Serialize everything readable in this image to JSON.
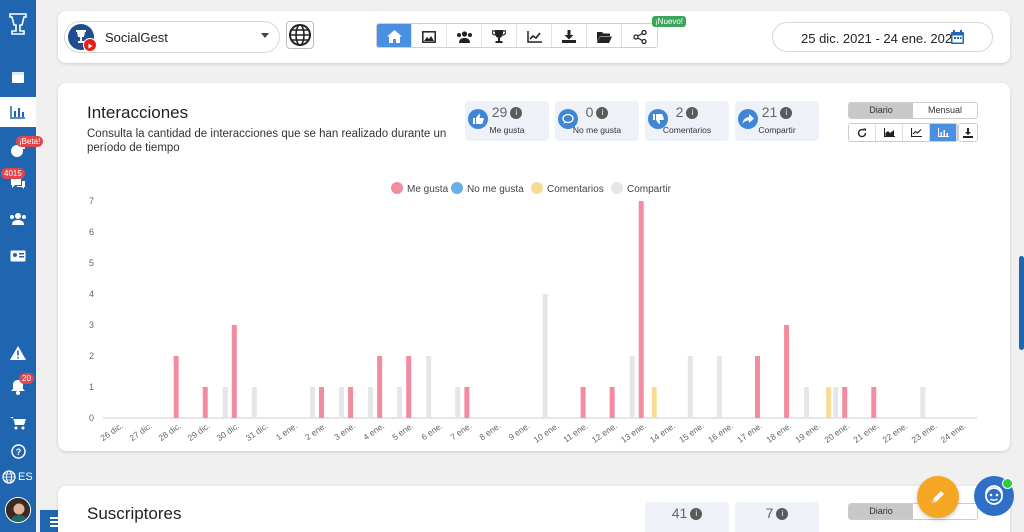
{
  "sidebar": {
    "items": [
      {
        "icon": "cup-logo-icon"
      },
      {
        "icon": "calendar-icon"
      },
      {
        "icon": "bar-chart-icon",
        "active": true
      },
      {
        "icon": "pie-chart-icon",
        "badge": "¡Beta!"
      },
      {
        "icon": "chat-icon",
        "badge": "4015"
      },
      {
        "icon": "users-icon"
      },
      {
        "icon": "id-card-icon"
      },
      {
        "icon": "warning-icon"
      },
      {
        "icon": "bell-icon",
        "badge": "20"
      },
      {
        "icon": "cart-icon"
      },
      {
        "icon": "help-icon"
      }
    ],
    "language": "ES"
  },
  "topbar": {
    "account_name": "SocialGest",
    "nuevo_badge": "¡Nuevo!",
    "date_range": "25 dic. 2021 - 24 ene. 2022",
    "nav_icons": [
      "home-icon",
      "image-icon",
      "users-icon",
      "trophy-icon",
      "line-chart-icon",
      "download-icon",
      "folder-icon",
      "share-nodes-icon"
    ]
  },
  "interactions": {
    "title": "Interacciones",
    "description": "Consulta la cantidad de interacciones que se han realizado durante un período de tiempo",
    "stats": [
      {
        "value": "29",
        "label": "Me gusta",
        "icon": "thumbs-up-icon"
      },
      {
        "value": "0",
        "label": "No me gusta",
        "icon": "speech-bubble-icon"
      },
      {
        "value": "2",
        "label": "Comentarios",
        "icon": "thumbs-down-icon"
      },
      {
        "value": "21",
        "label": "Compartir",
        "icon": "share-arrow-icon"
      }
    ],
    "period": {
      "daily": "Diario",
      "monthly": "Mensual"
    },
    "info_glyph": "i"
  },
  "chart_data": {
    "type": "bar",
    "categories": [
      "26 dic.",
      "27 dic.",
      "28 dic.",
      "29 dic.",
      "30 dic.",
      "31 dic.",
      "1 ene.",
      "2 ene.",
      "3 ene.",
      "4 ene.",
      "5 ene.",
      "6 ene.",
      "7 ene.",
      "8 ene.",
      "9 ene.",
      "10 ene.",
      "11 ene.",
      "12 ene.",
      "13 ene.",
      "14 ene.",
      "15 ene.",
      "16 ene.",
      "17 ene.",
      "18 ene.",
      "19 ene.",
      "20 ene.",
      "21 ene.",
      "22 ene.",
      "23 ene.",
      "24 ene."
    ],
    "series": [
      {
        "name": "Me gusta",
        "color": "#f48ca0",
        "values": [
          0,
          0,
          2,
          1,
          3,
          0,
          0,
          1,
          1,
          2,
          2,
          0,
          1,
          0,
          0,
          0,
          1,
          1,
          7,
          0,
          0,
          0,
          2,
          3,
          0,
          1,
          1,
          0,
          0,
          0
        ]
      },
      {
        "name": "No me gusta",
        "color": "#6aaee8",
        "values": [
          0,
          0,
          0,
          0,
          0,
          0,
          0,
          0,
          0,
          0,
          0,
          0,
          0,
          0,
          0,
          0,
          0,
          0,
          0,
          0,
          0,
          0,
          0,
          0,
          0,
          0,
          0,
          0,
          0,
          0
        ]
      },
      {
        "name": "Comentarios",
        "color": "#f8dc94",
        "values": [
          0,
          0,
          0,
          0,
          0,
          0,
          0,
          0,
          0,
          0,
          0,
          0,
          0,
          0,
          0,
          0,
          0,
          0,
          1,
          0,
          0,
          0,
          0,
          0,
          1,
          0,
          0,
          0,
          0,
          0
        ]
      },
      {
        "name": "Compartir",
        "color": "#e6e6ea",
        "values": [
          0,
          0,
          0,
          1,
          1,
          0,
          1,
          1,
          1,
          1,
          2,
          1,
          0,
          0,
          4,
          0,
          0,
          2,
          0,
          2,
          2,
          0,
          0,
          1,
          1,
          0,
          0,
          1,
          0,
          0
        ]
      }
    ],
    "ylim": [
      0,
      7
    ],
    "yticks": [
      "0",
      "1",
      "2",
      "3",
      "4",
      "5",
      "6",
      "7"
    ],
    "legend_position": "top-center",
    "grid": false
  },
  "subscribers": {
    "title": "Suscriptores",
    "stats": [
      {
        "value": "41"
      },
      {
        "value": "7"
      }
    ],
    "period": {
      "daily": "Diario"
    }
  }
}
